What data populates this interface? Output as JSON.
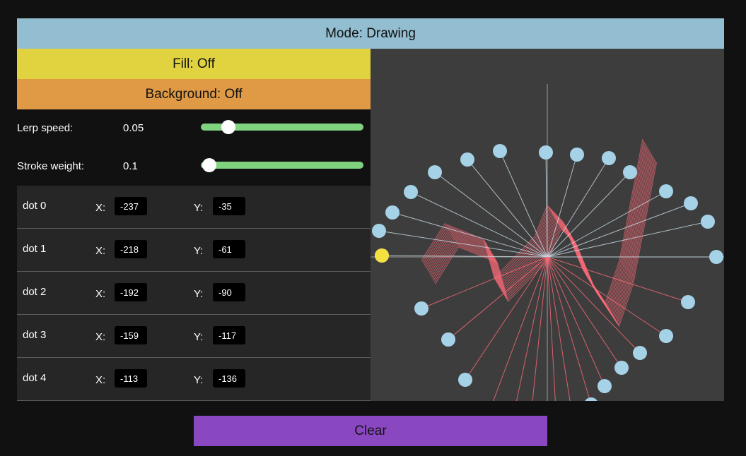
{
  "mode_label": "Mode: Drawing",
  "fill_label": "Fill: Off",
  "background_label": "Background: Off",
  "colors": {
    "mode": "#93bdd0",
    "fill": "#e0d33f",
    "background": "#e09a45",
    "clear": "#8a48c0",
    "slider_track": "#7fd37f",
    "canvas": "#3d3d3d",
    "dot": "#a6d2e8",
    "active_dot": "#f5e042",
    "ribbon": "#ff6b78"
  },
  "sliders": [
    {
      "label": "Lerp speed",
      "value": "0.05",
      "level": 0.17
    },
    {
      "label": "Stroke weight",
      "value": "0.1",
      "level": 0.05
    }
  ],
  "dots": [
    {
      "name": "dot 0",
      "x_label": "X:",
      "y_label": "Y:",
      "x": "-237",
      "y": "-35"
    },
    {
      "name": "dot 1",
      "x_label": "X:",
      "y_label": "Y:",
      "x": "-218",
      "y": "-61"
    },
    {
      "name": "dot 2",
      "x_label": "X:",
      "y_label": "Y:",
      "x": "-192",
      "y": "-90"
    },
    {
      "name": "dot 3",
      "x_label": "X:",
      "y_label": "Y:",
      "x": "-159",
      "y": "-117"
    },
    {
      "name": "dot 4",
      "x_label": "X:",
      "y_label": "Y:",
      "x": "-113",
      "y": "-136"
    }
  ],
  "clear_label": "Clear"
}
